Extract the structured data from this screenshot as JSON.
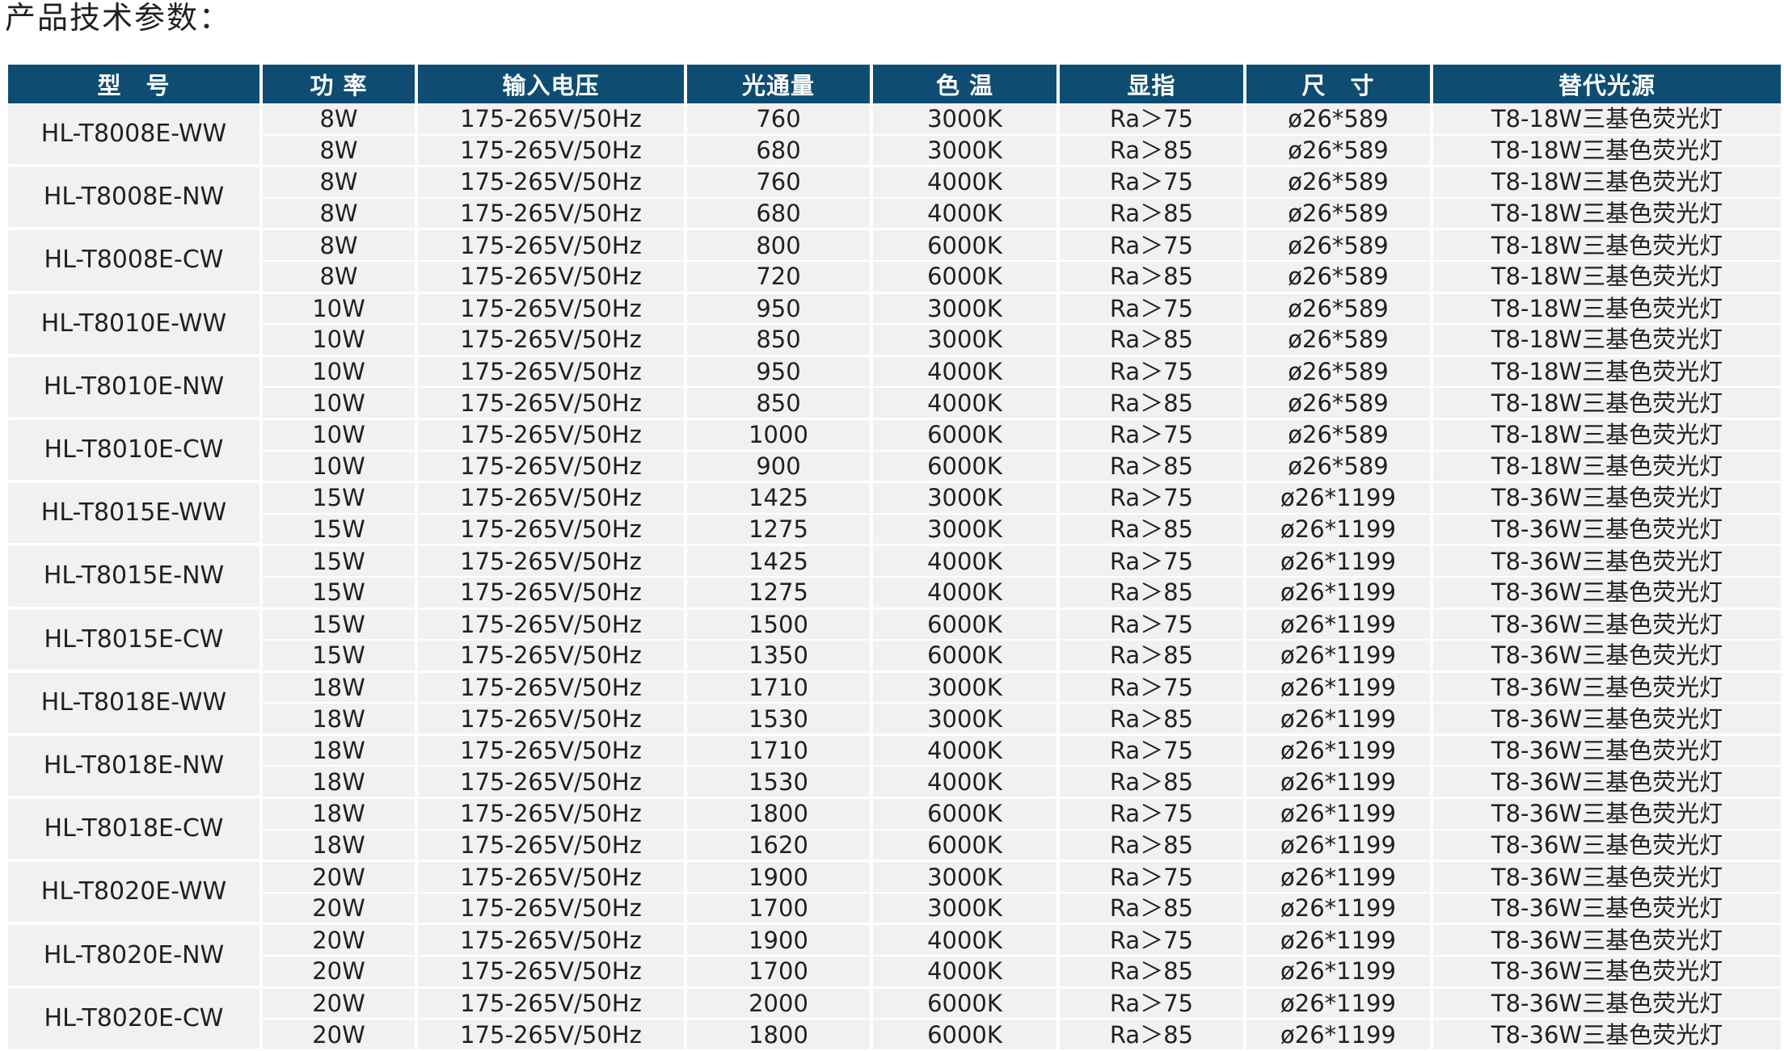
{
  "title": "产品技术参数：",
  "headers": [
    "型　号",
    "功 率",
    "输入电压",
    "光通量",
    "色 温",
    "显指",
    "尺　寸",
    "替代光源"
  ],
  "groups": [
    {
      "model": "HL-T8008E-WW",
      "rows": [
        [
          "8W",
          "175-265V/50Hz",
          "760",
          "3000K",
          "Ra＞75",
          "ø26*589",
          "T8-18W三基色荧光灯"
        ],
        [
          "8W",
          "175-265V/50Hz",
          "680",
          "3000K",
          "Ra＞85",
          "ø26*589",
          "T8-18W三基色荧光灯"
        ]
      ]
    },
    {
      "model": "HL-T8008E-NW",
      "rows": [
        [
          "8W",
          "175-265V/50Hz",
          "760",
          "4000K",
          "Ra＞75",
          "ø26*589",
          "T8-18W三基色荧光灯"
        ],
        [
          "8W",
          "175-265V/50Hz",
          "680",
          "4000K",
          "Ra＞85",
          "ø26*589",
          "T8-18W三基色荧光灯"
        ]
      ]
    },
    {
      "model": "HL-T8008E-CW",
      "rows": [
        [
          "8W",
          "175-265V/50Hz",
          "800",
          "6000K",
          "Ra＞75",
          "ø26*589",
          "T8-18W三基色荧光灯"
        ],
        [
          "8W",
          "175-265V/50Hz",
          "720",
          "6000K",
          "Ra＞85",
          "ø26*589",
          "T8-18W三基色荧光灯"
        ]
      ]
    },
    {
      "model": "HL-T8010E-WW",
      "rows": [
        [
          "10W",
          "175-265V/50Hz",
          "950",
          "3000K",
          "Ra＞75",
          "ø26*589",
          "T8-18W三基色荧光灯"
        ],
        [
          "10W",
          "175-265V/50Hz",
          "850",
          "3000K",
          "Ra＞85",
          "ø26*589",
          "T8-18W三基色荧光灯"
        ]
      ]
    },
    {
      "model": "HL-T8010E-NW",
      "rows": [
        [
          "10W",
          "175-265V/50Hz",
          "950",
          "4000K",
          "Ra＞75",
          "ø26*589",
          "T8-18W三基色荧光灯"
        ],
        [
          "10W",
          "175-265V/50Hz",
          "850",
          "4000K",
          "Ra＞85",
          "ø26*589",
          "T8-18W三基色荧光灯"
        ]
      ]
    },
    {
      "model": "HL-T8010E-CW",
      "rows": [
        [
          "10W",
          "175-265V/50Hz",
          "1000",
          "6000K",
          "Ra＞75",
          "ø26*589",
          "T8-18W三基色荧光灯"
        ],
        [
          "10W",
          "175-265V/50Hz",
          "900",
          "6000K",
          "Ra＞85",
          "ø26*589",
          "T8-18W三基色荧光灯"
        ]
      ]
    },
    {
      "model": "HL-T8015E-WW",
      "rows": [
        [
          "15W",
          "175-265V/50Hz",
          "1425",
          "3000K",
          "Ra＞75",
          "ø26*1199",
          "T8-36W三基色荧光灯"
        ],
        [
          "15W",
          "175-265V/50Hz",
          "1275",
          "3000K",
          "Ra＞85",
          "ø26*1199",
          "T8-36W三基色荧光灯"
        ]
      ]
    },
    {
      "model": "HL-T8015E-NW",
      "rows": [
        [
          "15W",
          "175-265V/50Hz",
          "1425",
          "4000K",
          "Ra＞75",
          "ø26*1199",
          "T8-36W三基色荧光灯"
        ],
        [
          "15W",
          "175-265V/50Hz",
          "1275",
          "4000K",
          "Ra＞85",
          "ø26*1199",
          "T8-36W三基色荧光灯"
        ]
      ]
    },
    {
      "model": "HL-T8015E-CW",
      "rows": [
        [
          "15W",
          "175-265V/50Hz",
          "1500",
          "6000K",
          "Ra＞75",
          "ø26*1199",
          "T8-36W三基色荧光灯"
        ],
        [
          "15W",
          "175-265V/50Hz",
          "1350",
          "6000K",
          "Ra＞85",
          "ø26*1199",
          "T8-36W三基色荧光灯"
        ]
      ]
    },
    {
      "model": "HL-T8018E-WW",
      "rows": [
        [
          "18W",
          "175-265V/50Hz",
          "1710",
          "3000K",
          "Ra＞75",
          "ø26*1199",
          "T8-36W三基色荧光灯"
        ],
        [
          "18W",
          "175-265V/50Hz",
          "1530",
          "3000K",
          "Ra＞85",
          "ø26*1199",
          "T8-36W三基色荧光灯"
        ]
      ]
    },
    {
      "model": "HL-T8018E-NW",
      "rows": [
        [
          "18W",
          "175-265V/50Hz",
          "1710",
          "4000K",
          "Ra＞75",
          "ø26*1199",
          "T8-36W三基色荧光灯"
        ],
        [
          "18W",
          "175-265V/50Hz",
          "1530",
          "4000K",
          "Ra＞85",
          "ø26*1199",
          "T8-36W三基色荧光灯"
        ]
      ]
    },
    {
      "model": "HL-T8018E-CW",
      "rows": [
        [
          "18W",
          "175-265V/50Hz",
          "1800",
          "6000K",
          "Ra＞75",
          "ø26*1199",
          "T8-36W三基色荧光灯"
        ],
        [
          "18W",
          "175-265V/50Hz",
          "1620",
          "6000K",
          "Ra＞85",
          "ø26*1199",
          "T8-36W三基色荧光灯"
        ]
      ]
    },
    {
      "model": "HL-T8020E-WW",
      "rows": [
        [
          "20W",
          "175-265V/50Hz",
          "1900",
          "3000K",
          "Ra＞75",
          "ø26*1199",
          "T8-36W三基色荧光灯"
        ],
        [
          "20W",
          "175-265V/50Hz",
          "1700",
          "3000K",
          "Ra＞85",
          "ø26*1199",
          "T8-36W三基色荧光灯"
        ]
      ]
    },
    {
      "model": "HL-T8020E-NW",
      "rows": [
        [
          "20W",
          "175-265V/50Hz",
          "1900",
          "4000K",
          "Ra＞75",
          "ø26*1199",
          "T8-36W三基色荧光灯"
        ],
        [
          "20W",
          "175-265V/50Hz",
          "1700",
          "4000K",
          "Ra＞85",
          "ø26*1199",
          "T8-36W三基色荧光灯"
        ]
      ]
    },
    {
      "model": "HL-T8020E-CW",
      "rows": [
        [
          "20W",
          "175-265V/50Hz",
          "2000",
          "6000K",
          "Ra＞75",
          "ø26*1199",
          "T8-36W三基色荧光灯"
        ],
        [
          "20W",
          "175-265V/50Hz",
          "1800",
          "6000K",
          "Ra＞85",
          "ø26*1199",
          "T8-36W三基色荧光灯"
        ]
      ]
    }
  ],
  "colors": {
    "header_bg": "#0e4d71",
    "header_text": "#ffffff",
    "row_bg": "#f1f1f1",
    "text": "#231f20"
  }
}
